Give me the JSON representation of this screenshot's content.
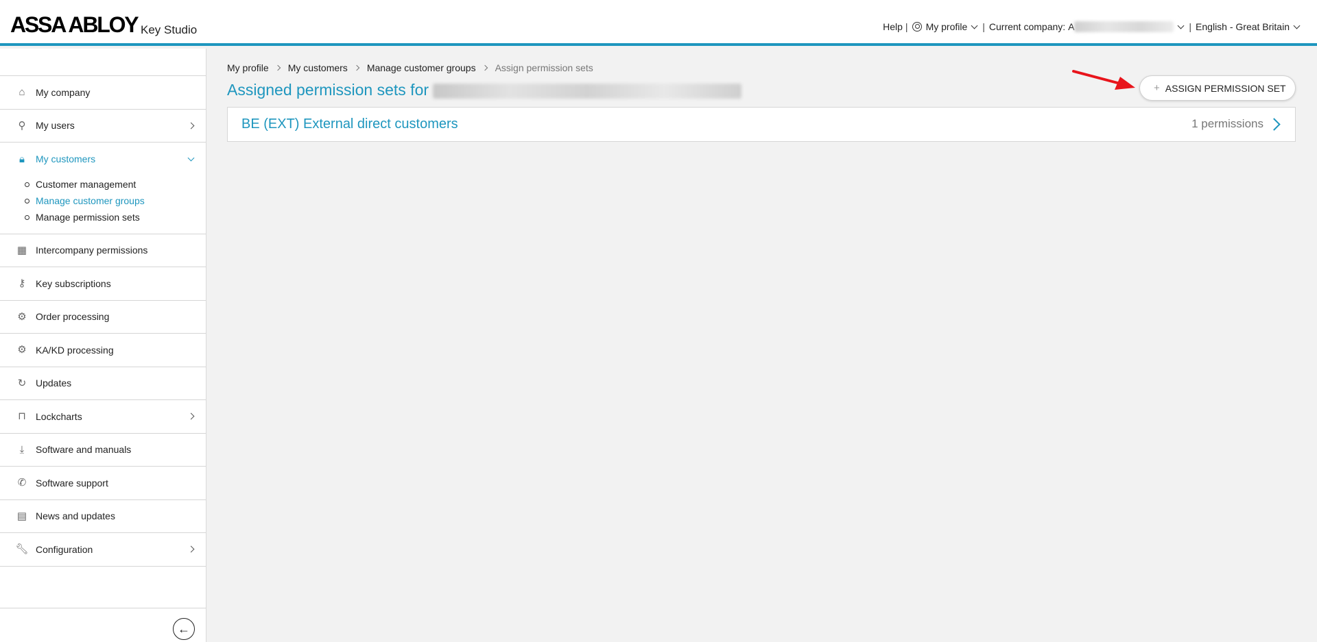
{
  "header": {
    "logo": "ASSA ABLOY",
    "product": "Key Studio",
    "help": "Help",
    "profile": "My profile",
    "company_label": "Current company:",
    "company_value_hidden": "A",
    "language": "English - Great Britain"
  },
  "sidebar": {
    "items": [
      {
        "label": "My company",
        "icon": "home-icon"
      },
      {
        "label": "My users",
        "icon": "user-icon"
      },
      {
        "label": "My customers",
        "icon": "lock-icon"
      },
      {
        "label": "Intercompany permissions",
        "icon": "building-icon"
      },
      {
        "label": "Key subscriptions",
        "icon": "key-icon"
      },
      {
        "label": "Order processing",
        "icon": "gear-icon"
      },
      {
        "label": "KA/KD processing",
        "icon": "gears-icon"
      },
      {
        "label": "Updates",
        "icon": "refresh-icon"
      },
      {
        "label": "Lockcharts",
        "icon": "door-icon"
      },
      {
        "label": "Software and manuals",
        "icon": "download-icon"
      },
      {
        "label": "Software support",
        "icon": "phone-icon"
      },
      {
        "label": "News and updates",
        "icon": "newspaper-icon"
      },
      {
        "label": "Configuration",
        "icon": "wrench-icon"
      }
    ],
    "subitems": [
      {
        "label": "Customer management"
      },
      {
        "label": "Manage customer groups"
      },
      {
        "label": "Manage permission sets"
      }
    ]
  },
  "breadcrumb": [
    "My profile",
    "My customers",
    "Manage customer groups",
    "Assign permission sets"
  ],
  "main": {
    "title": "Assigned permission sets for",
    "assign_button": "ASSIGN PERMISSION SET",
    "permission_sets": [
      {
        "name": "BE (EXT) External direct customers",
        "count": "1 permissions"
      }
    ]
  },
  "colors": {
    "accent": "#1e96be",
    "arrow": "#e8141b"
  }
}
